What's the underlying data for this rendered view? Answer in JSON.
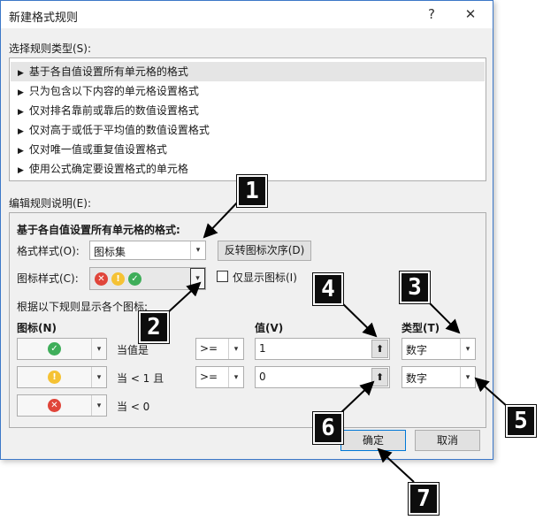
{
  "dialog": {
    "title": "新建格式规则",
    "help_glyph": "?",
    "close_glyph": "✕"
  },
  "rule_type": {
    "label": "选择规则类型(S):",
    "items": [
      "基于各自值设置所有单元格的格式",
      "只为包含以下内容的单元格设置格式",
      "仅对排名靠前或靠后的数值设置格式",
      "仅对高于或低于平均值的数值设置格式",
      "仅对唯一值或重复值设置格式",
      "使用公式确定要设置格式的单元格"
    ]
  },
  "edit": {
    "label": "编辑规则说明(E):",
    "heading": "基于各自值设置所有单元格的格式:",
    "format_style_label": "格式样式(O):",
    "format_style_value": "图标集",
    "reverse_button": "反转图标次序(D)",
    "icon_style_label": "图标样式(C):",
    "show_icon_only_label": "仅显示图标(I)",
    "rules_caption": "根据以下规则显示各个图标:",
    "col_icon": "图标(N)",
    "col_value": "值(V)",
    "col_type": "类型(T)",
    "rows": [
      {
        "icon": "green-check-icon",
        "condition": "当值是",
        "operator": ">=",
        "value": "1",
        "type": "数字"
      },
      {
        "icon": "yellow-exclamation-icon",
        "condition": "当 < 1 且",
        "operator": ">=",
        "value": "0",
        "type": "数字"
      },
      {
        "icon": "red-x-icon",
        "condition": "当 < 0",
        "operator": "",
        "value": "",
        "type": ""
      }
    ]
  },
  "buttons": {
    "ok": "确定",
    "cancel": "取消"
  },
  "callouts": [
    "1",
    "2",
    "3",
    "4",
    "5",
    "6",
    "7"
  ],
  "colors": {
    "accent": "#0078d7",
    "dialog_bg": "#f0f0f0",
    "icon_red": "#e0453a",
    "icon_yellow": "#f5c234",
    "icon_green": "#3fae5a"
  }
}
